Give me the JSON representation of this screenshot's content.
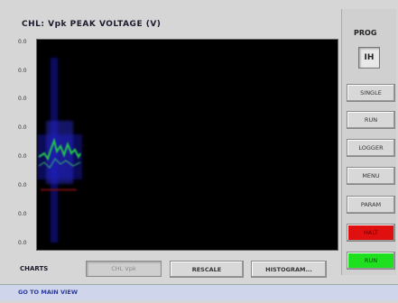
{
  "header": {
    "title": "CHL: Vpk PEAK VOLTAGE (V)"
  },
  "y_ticks": [
    "0.0",
    "0.0",
    "0.0",
    "0.0",
    "0.0",
    "0.0",
    "0.0",
    "0.0"
  ],
  "right_panel": {
    "prog_label": "PROG",
    "prog_value": "IH",
    "buttons": [
      {
        "label": "SINGLE",
        "style": "normal"
      },
      {
        "label": "RUN",
        "style": "normal"
      },
      {
        "label": "LOGGER",
        "style": "normal"
      },
      {
        "label": "MENU",
        "style": "normal"
      },
      {
        "label": "PARAM",
        "style": "normal"
      },
      {
        "label": "HALT",
        "style": "red"
      },
      {
        "label": "RUN",
        "style": "green"
      }
    ]
  },
  "bottom_bar": {
    "channel_label": "CHARTS",
    "channel_value": "CHL Vpk",
    "rescale_label": "RESCALE",
    "histogram_label": "HISTOGRAM..."
  },
  "status_bar": {
    "text": "GO TO MAIN VIEW"
  },
  "colors": {
    "plot_bg": "#000000",
    "halt": "#e01010",
    "run": "#1ee01e"
  }
}
